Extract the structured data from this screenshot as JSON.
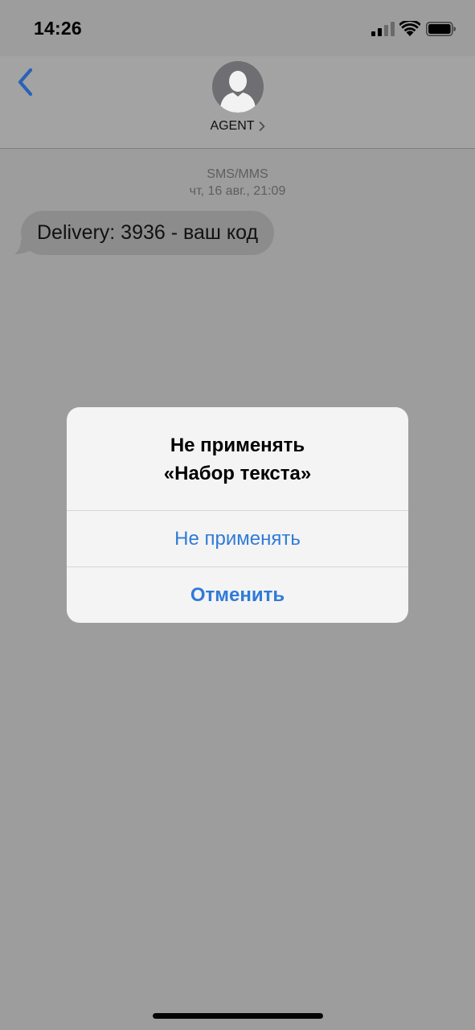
{
  "status_bar": {
    "time": "14:26",
    "icons": [
      "signal-icon",
      "wifi-icon",
      "battery-icon"
    ]
  },
  "header": {
    "back_icon": "chevron-left-icon",
    "contact_name": "AGENT",
    "avatar_icon": "person-silhouette-icon"
  },
  "conversation": {
    "meta_line1": "SMS/MMS",
    "meta_line2": "чт, 16 авг., 21:09",
    "messages": [
      {
        "text": "Delivery: 3936 - ваш код",
        "direction": "incoming"
      }
    ]
  },
  "alert": {
    "title_line1": "Не применять",
    "title_line2": "«Набор текста»",
    "buttons": [
      {
        "label": "Не применять",
        "style": "default"
      },
      {
        "label": "Отменить",
        "style": "cancel"
      }
    ]
  },
  "colors": {
    "accent": "#2f7bd8",
    "dimmed_background": "#9d9d9d",
    "alert_background": "#f4f4f4",
    "incoming_bubble": "#8c8c8c"
  }
}
